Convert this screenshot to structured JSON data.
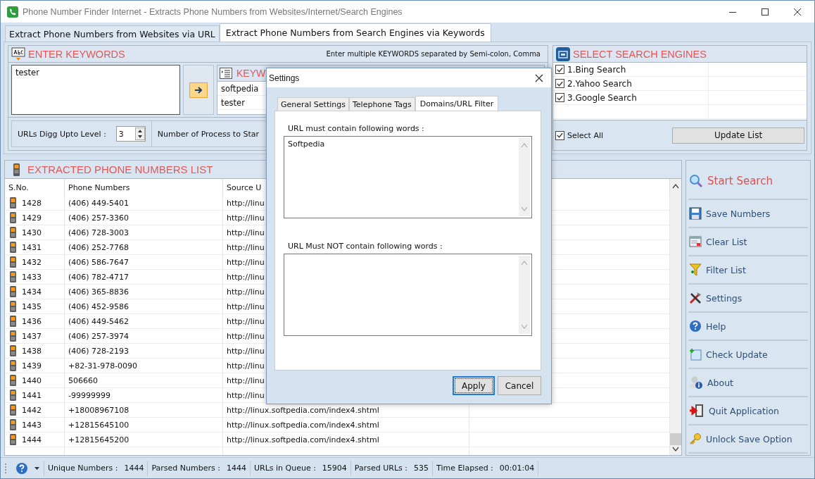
{
  "window": {
    "title": "Phone Number Finder Internet - Extracts Phone Numbers from Websites/Internet/Search Engines"
  },
  "tabs": [
    {
      "label": "Extract Phone Numbers from Websites via URL",
      "selected": false
    },
    {
      "label": "Extract Phone Numbers from Search Engines via Keywords",
      "selected": true
    }
  ],
  "keywords": {
    "title": "ENTER KEYWORDS",
    "hint": "Enter multiple KEYWORDS separated by Semi-colon, Comma",
    "input": "tester",
    "list_title": "KEYW",
    "list": [
      "softpedia",
      "tester"
    ],
    "digg_label": "URLs Digg Upto Level :",
    "digg_value": "3",
    "process_label": "Number of Process to Star"
  },
  "engines": {
    "title": "SELECT SEARCH ENGINES",
    "items": [
      {
        "label": "1.Bing Search",
        "checked": true
      },
      {
        "label": "2.Yahoo Search",
        "checked": true
      },
      {
        "label": "3.Google Search",
        "checked": true
      }
    ],
    "select_all": {
      "label": "Select All",
      "checked": true
    },
    "update_button": "Update List"
  },
  "phone_list": {
    "title": "EXTRACTED PHONE NUMBERS LIST",
    "columns": [
      "S.No.",
      "Phone Numbers",
      "Source U"
    ],
    "rows": [
      {
        "sno": "1428",
        "phone": "(406) 449-5401",
        "source": "http://linu"
      },
      {
        "sno": "1429",
        "phone": "(406) 257-3360",
        "source": "http://linu"
      },
      {
        "sno": "1430",
        "phone": "(406) 728-3003",
        "source": "http://linu"
      },
      {
        "sno": "1431",
        "phone": "(406) 252-7768",
        "source": "http://linu"
      },
      {
        "sno": "1432",
        "phone": "(406) 586-7647",
        "source": "http://linu"
      },
      {
        "sno": "1433",
        "phone": "(406) 782-4717",
        "source": "http://linu"
      },
      {
        "sno": "1434",
        "phone": "(406) 365-8836",
        "source": "http://linu"
      },
      {
        "sno": "1435",
        "phone": "(406) 452-9586",
        "source": "http://linu"
      },
      {
        "sno": "1436",
        "phone": "(406) 449-5462",
        "source": "http://linu"
      },
      {
        "sno": "1437",
        "phone": "(406) 257-3974",
        "source": "http://linu"
      },
      {
        "sno": "1438",
        "phone": "(406) 728-2193",
        "source": "http://linu"
      },
      {
        "sno": "1439",
        "phone": "+82-31-978-0090",
        "source": "http://linu"
      },
      {
        "sno": "1440",
        "phone": "506660",
        "source": "http://linu"
      },
      {
        "sno": "1441",
        "phone": "-99999999",
        "source": "http://linu"
      },
      {
        "sno": "1442",
        "phone": "+18008967108",
        "source": "http://linux.softpedia.com/index4.shtml"
      },
      {
        "sno": "1443",
        "phone": "+12815645100",
        "source": "http://linux.softpedia.com/index4.shtml"
      },
      {
        "sno": "1444",
        "phone": "+12815645200",
        "source": "http://linux.softpedia.com/index4.shtml"
      }
    ]
  },
  "actions": [
    {
      "label": "Start Search",
      "kind": "primary"
    },
    {
      "label": "Save Numbers",
      "kind": "normal"
    },
    {
      "label": "Clear List",
      "kind": "normal"
    },
    {
      "label": "Filter List",
      "kind": "normal"
    },
    {
      "label": "Settings",
      "kind": "normal"
    },
    {
      "label": "Help",
      "kind": "normal"
    },
    {
      "label": "Check Update",
      "kind": "normal"
    },
    {
      "label": "About",
      "kind": "normal"
    },
    {
      "label": "Quit Application",
      "kind": "normal"
    },
    {
      "label": "Unlock Save Option",
      "kind": "normal"
    }
  ],
  "status_bar": [
    {
      "label": "Unique Numbers :",
      "value": "1444"
    },
    {
      "label": "Parsed Numbers :",
      "value": "1444"
    },
    {
      "label": "URLs in Queue :",
      "value": "15904"
    },
    {
      "label": "Parsed URLs :",
      "value": "535"
    },
    {
      "label": "Time Elapsed :",
      "value": "00:01:04"
    }
  ],
  "dialog": {
    "title": "Settings",
    "tabs": [
      {
        "label": "General Settings",
        "selected": false
      },
      {
        "label": "Telephone Tags",
        "selected": false
      },
      {
        "label": "Domains/URL Filter",
        "selected": true
      }
    ],
    "fields": [
      {
        "label": "URL must contain following words :",
        "value": "Softpedia"
      },
      {
        "label": "URL Must NOT contain following words :"
      }
    ],
    "buttons": [
      {
        "label": "Apply",
        "default": true
      },
      {
        "label": "Cancel",
        "default": false
      }
    ]
  }
}
